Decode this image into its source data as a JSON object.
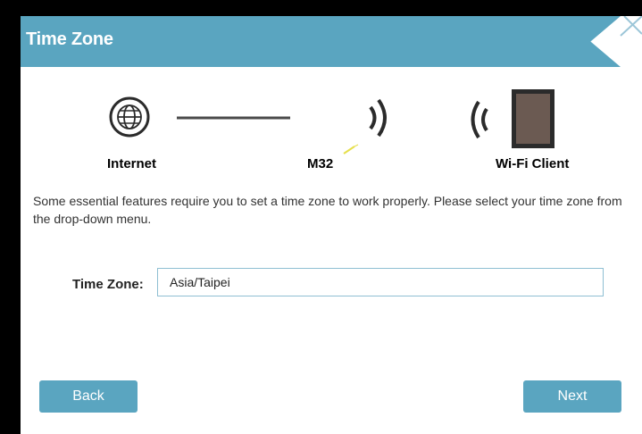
{
  "dialog": {
    "title": "Time Zone"
  },
  "diagram": {
    "internet_label": "Internet",
    "device_label": "M32",
    "client_label": "Wi-Fi Client"
  },
  "intro": {
    "text": "Some essential features require you to set a time zone to work properly. Please select your time zone from the drop-down menu."
  },
  "form": {
    "time_zone_label": "Time Zone:",
    "time_zone_value": "Asia/Taipei"
  },
  "buttons": {
    "back": "Back",
    "next": "Next"
  },
  "colors": {
    "accent": "#5aa5c0",
    "input_border": "#8fbfd3",
    "background": "#ffffff"
  },
  "icons": [
    "globe-icon",
    "connection-line",
    "wifi-signal-right-icon",
    "wifi-signal-left-icon",
    "tablet-icon",
    "close-icon"
  ]
}
